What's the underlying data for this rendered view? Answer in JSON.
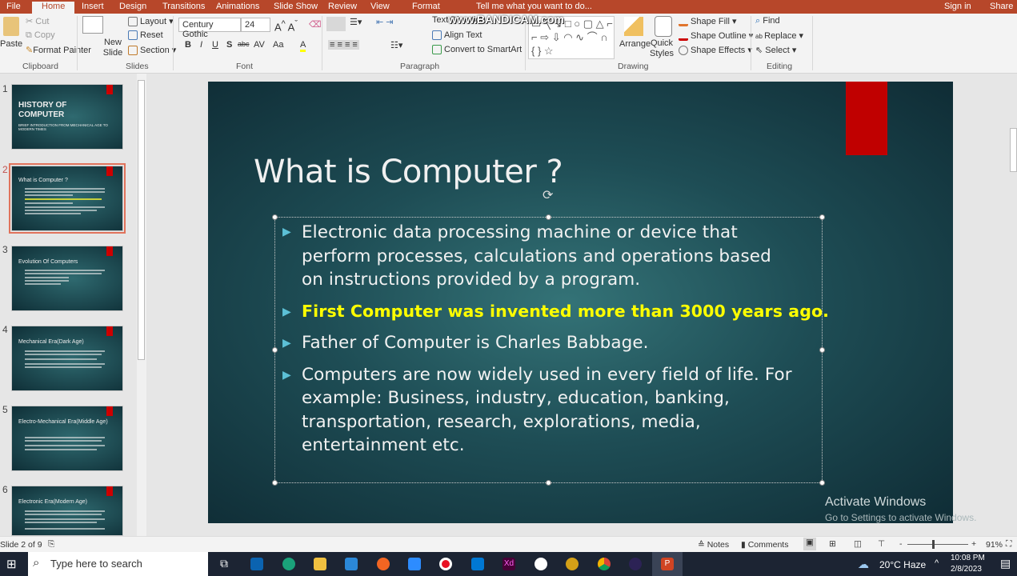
{
  "ribbon_tabs": [
    "File",
    "Home",
    "Insert",
    "Design",
    "Transitions",
    "Animations",
    "Slide Show",
    "Review",
    "View",
    "Format"
  ],
  "tell_me": "Tell me what you want to do...",
  "sign_in": "Sign in",
  "share": "Share",
  "watermark_recorder": "www.BANDICAM.com",
  "clipboard": {
    "paste": "Paste",
    "cut": "Cut",
    "copy": "Copy",
    "format_painter": "Format Painter",
    "group": "Clipboard"
  },
  "slides_group": {
    "new_slide": "New Slide",
    "layout": "Layout",
    "reset": "Reset",
    "section": "Section",
    "group": "Slides"
  },
  "font": {
    "name": "Century Gothic",
    "size": "24",
    "group": "Font",
    "bold": "B",
    "italic": "I",
    "underline": "U",
    "shadow": "S",
    "strike": "abc",
    "spacing": "AV",
    "case": "Aa",
    "color": "A"
  },
  "paragraph": {
    "text_direction": "Text Direction",
    "align_text": "Align Text",
    "smartart": "Convert to SmartArt",
    "group": "Paragraph"
  },
  "drawing": {
    "arrange": "Arrange",
    "quick_styles": "Quick Styles",
    "shape_fill": "Shape Fill",
    "shape_outline": "Shape Outline",
    "shape_effects": "Shape Effects",
    "group": "Drawing"
  },
  "editing": {
    "find": "Find",
    "replace": "Replace",
    "select": "Select",
    "group": "Editing"
  },
  "thumbnails": [
    {
      "num": "1",
      "title": "HISTORY OF COMPUTER",
      "subtitle": "BRIEF INTRODUCTION FROM MECHANICAL AGE TO MODERN TIMES"
    },
    {
      "num": "2",
      "title": "What is Computer ?"
    },
    {
      "num": "3",
      "title": "Evolution Of Computers"
    },
    {
      "num": "4",
      "title": "Mechanical Era(Dark Age)"
    },
    {
      "num": "5",
      "title": "Electro-Mechanical Era(Middle Age)"
    },
    {
      "num": "6",
      "title": "Electronic Era(Modern Age)"
    }
  ],
  "slide": {
    "title": "What is Computer ?",
    "bullets": [
      {
        "lines": [
          "Electronic data processing machine or device that",
          "perform processes, calculations and operations based",
          "on instructions provided by a program."
        ]
      },
      {
        "lines": [
          "First Computer was invented more than 3000 years ago."
        ],
        "highlight": true
      },
      {
        "lines": [
          "Father of Computer is Charles Babbage."
        ]
      },
      {
        "lines": [
          "Computers are now widely used in every field of life. For",
          "example: Business, industry, education, banking,",
          "transportation, research, explorations, media,",
          "entertainment etc."
        ]
      }
    ],
    "accent": "#c00000",
    "highlight_color": "#ffff00"
  },
  "activate": {
    "title": "Activate Windows",
    "sub": "Go to Settings to activate Windows."
  },
  "status": {
    "slide": "Slide 2 of 9",
    "notes": "Notes",
    "comments": "Comments",
    "zoom": "91%"
  },
  "taskbar": {
    "search": "Type here to search",
    "weather": "20°C  Haze",
    "time": "10:08 PM",
    "date": "2/8/2023"
  }
}
